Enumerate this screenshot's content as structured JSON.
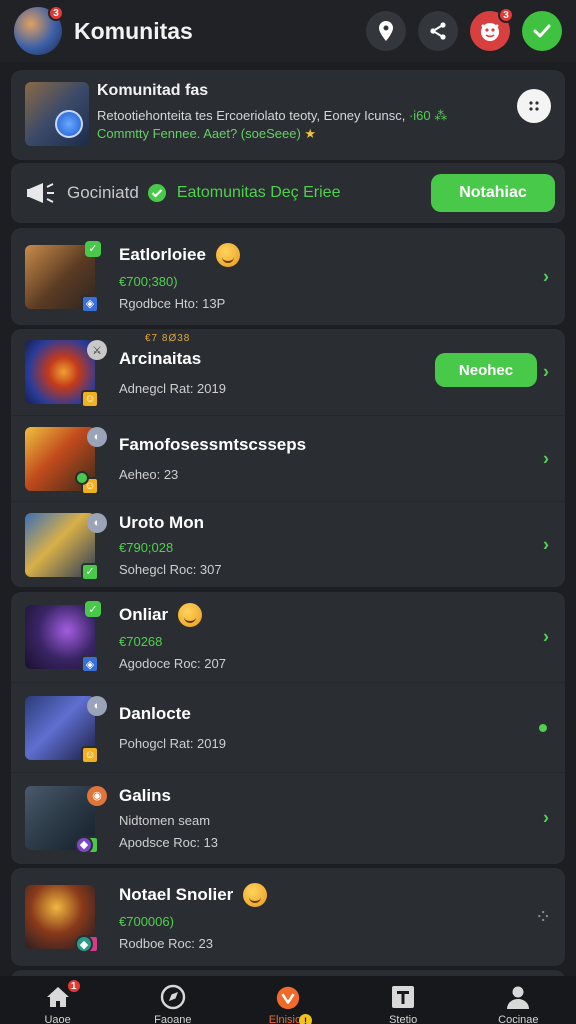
{
  "header": {
    "title": "Komunitas",
    "avatar_badge": "3",
    "mascot_badge": "3"
  },
  "community": {
    "title": "Komunitad fas",
    "desc_main": "Retootiehonteita tes Ercoeriolato teoty, Eoney Icunsc,",
    "desc_green": "·i60 ⁂",
    "sub_main": "Commtty Fennee. Aaet? (soeSeee)",
    "sub_star": "★"
  },
  "filter": {
    "label": "Gociniatd",
    "status": "Eatomunitas Deç Eriee",
    "button": "Notahiac"
  },
  "items": [
    {
      "pre": "",
      "title": "Eatlorloiee",
      "price": "€700;380)",
      "sub": "Rgodbce Hto: 13P",
      "emoji": true,
      "action": ""
    },
    {
      "pre": "€7 8Ø38",
      "title": "Arcinaitas",
      "price": "",
      "sub": "Adnegcl Rat: 2019",
      "emoji": false,
      "action": "Neohec"
    },
    {
      "pre": "",
      "title": "Famofosessmtscsseps",
      "price": "",
      "sub": "Aeheo: 23",
      "emoji": false,
      "action": ""
    },
    {
      "pre": "",
      "title": "Uroto Mon",
      "price": "€790;028",
      "sub": "Sohegcl Roc: 307",
      "emoji": false,
      "action": ""
    },
    {
      "pre": "",
      "title": "Onliar",
      "price": "€70268",
      "sub": "Agodoce Roc: 207",
      "emoji": true,
      "action": ""
    },
    {
      "pre": "",
      "title": "Danlocte",
      "price": "",
      "sub": "Pohogcl Rat: 2019",
      "emoji": false,
      "action": ""
    },
    {
      "pre": "",
      "title": "Galins",
      "price": "Nidtomen seam",
      "sub": "Apodsce Roc: 13",
      "emoji": false,
      "action": ""
    },
    {
      "pre": "",
      "title": "Notael Snolier",
      "price": "€700006)",
      "sub": "Rodboe Roc: 23",
      "emoji": true,
      "action": ""
    }
  ],
  "nav": [
    {
      "label": "Uaoe",
      "icon": "home-icon"
    },
    {
      "label": "Faoane",
      "icon": "compass-icon"
    },
    {
      "label": "Elnisioe",
      "icon": "mascot-icon"
    },
    {
      "label": "Stetio",
      "icon": "store-icon"
    },
    {
      "label": "Cocinae",
      "icon": "profile-icon"
    }
  ],
  "nav_badges": {
    "home": "1",
    "active": "!"
  },
  "colors": {
    "accent_green": "#49c94a",
    "active_orange": "#f06a2a",
    "background": "#1c1e22"
  }
}
